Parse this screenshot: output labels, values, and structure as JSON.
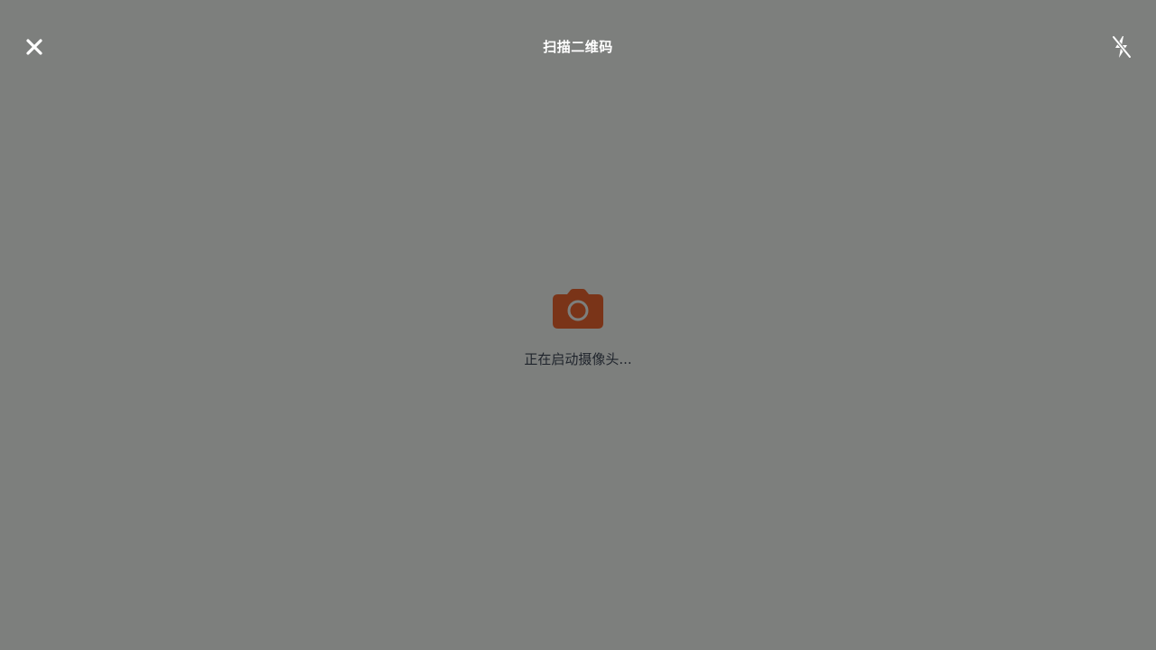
{
  "header": {
    "title": "扫描二维码",
    "close_icon": "close-icon",
    "flash_icon": "flash-off-icon"
  },
  "loading": {
    "icon": "camera-icon",
    "text": "正在启动摄像头...",
    "icon_color": "#7a3418"
  },
  "colors": {
    "background": "#7d7f7d",
    "header_text": "#ffffff",
    "status_text": "#1f242c"
  }
}
